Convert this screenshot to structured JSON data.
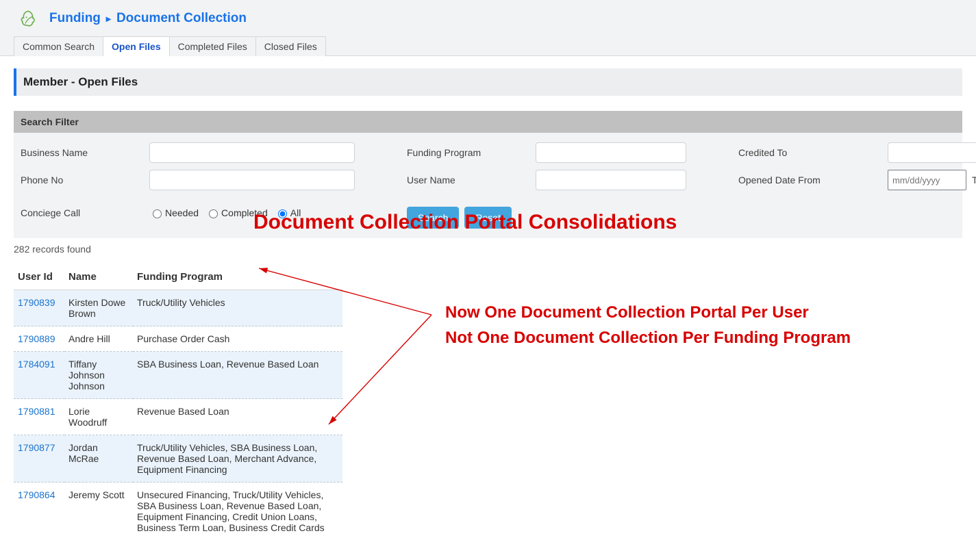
{
  "header": {
    "crumb1": "Funding",
    "crumb2": "Document Collection",
    "tabs": {
      "common": "Common Search",
      "open": "Open Files",
      "completed": "Completed Files",
      "closed": "Closed Files"
    }
  },
  "section": {
    "title": "Member - Open Files"
  },
  "filter": {
    "title": "Search Filter",
    "labels": {
      "businessName": "Business Name",
      "fundingProgram": "Funding Program",
      "creditedTo": "Credited To",
      "phoneNo": "Phone No",
      "userName": "User Name",
      "openedFrom": "Opened Date From",
      "to": "To",
      "concierge": "Conciege Call"
    },
    "radios": {
      "needed": "Needed",
      "completed": "Completed",
      "all": "All",
      "selected": "all"
    },
    "datePlaceholder": "mm/dd/yyyy",
    "buttons": {
      "search": "Search",
      "reset": "Reset"
    }
  },
  "records": {
    "countText": "282 records found"
  },
  "table": {
    "headers": {
      "userId": "User Id",
      "name": "Name",
      "fundingProgram": "Funding Program"
    },
    "rows": [
      {
        "id": "1790839",
        "name": "Kirsten Dowe Brown",
        "prog": "Truck/Utility Vehicles"
      },
      {
        "id": "1790889",
        "name": "Andre Hill",
        "prog": "Purchase Order Cash"
      },
      {
        "id": "1784091",
        "name": "Tiffany Johnson Johnson",
        "prog": "SBA Business Loan, Revenue Based Loan"
      },
      {
        "id": "1790881",
        "name": "Lorie Woodruff",
        "prog": "Revenue Based Loan"
      },
      {
        "id": "1790877",
        "name": "Jordan McRae",
        "prog": "Truck/Utility Vehicles, SBA Business Loan, Revenue Based Loan, Merchant Advance, Equipment Financing"
      },
      {
        "id": "1790864",
        "name": "Jeremy Scott",
        "prog": "Unsecured Financing, Truck/Utility Vehicles, SBA Business Loan, Revenue Based Loan, Equipment Financing, Credit Union Loans, Business Term Loan, Business Credit Cards"
      }
    ]
  },
  "annotations": {
    "title": "Document Collection Portal Consolidations",
    "line1": "Now One Document Collection Portal Per User",
    "line2": "Not One Document Collection Per Funding Program"
  }
}
